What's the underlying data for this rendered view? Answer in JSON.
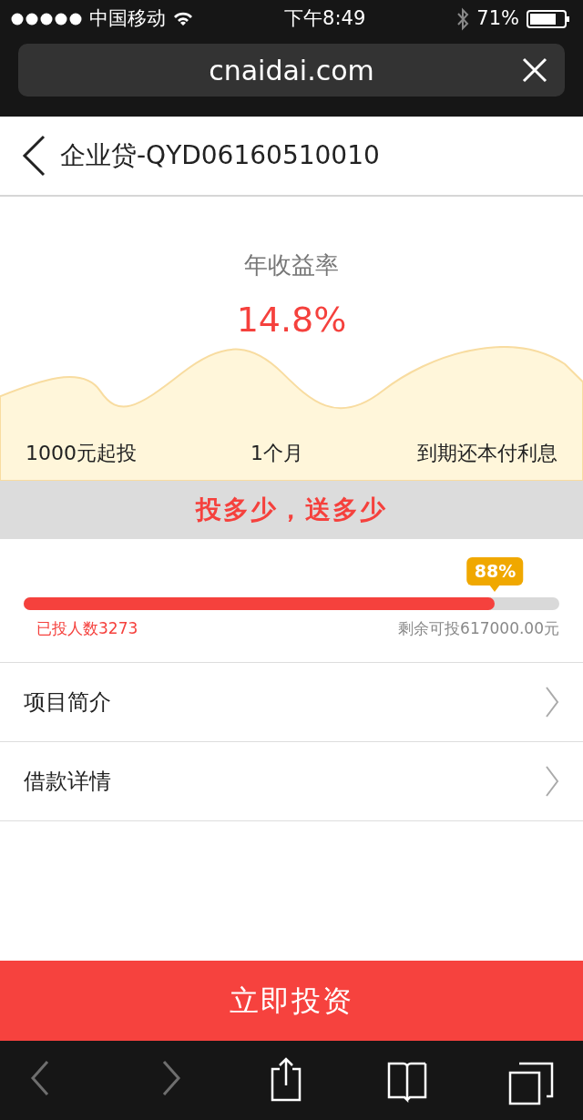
{
  "status_bar": {
    "carrier": "中国移动",
    "time": "下午8:49",
    "battery": "71%"
  },
  "address_bar": {
    "url": "cnaidai.com"
  },
  "header": {
    "title": "企业贷-QYD06160510010"
  },
  "rate": {
    "label": "年收益率",
    "value": "14.8%"
  },
  "terms": [
    "1000元起投",
    "1个月",
    "到期还本付利息"
  ],
  "promo": "投多少，送多少",
  "progress": {
    "level": 0.88,
    "badge": "88%",
    "investors": "已投人数3273",
    "remaining": "剩余可投617000.00元"
  },
  "menu": [
    {
      "label": "项目简介"
    },
    {
      "label": "借款详情"
    }
  ],
  "invest_button": "立即投资",
  "toolbar": [
    {
      "kind": "back",
      "disabled": true
    },
    {
      "kind": "forward",
      "disabled": true
    },
    {
      "kind": "share",
      "disabled": false
    },
    {
      "kind": "bookmarks",
      "disabled": false
    },
    {
      "kind": "tabs",
      "disabled": false
    }
  ]
}
